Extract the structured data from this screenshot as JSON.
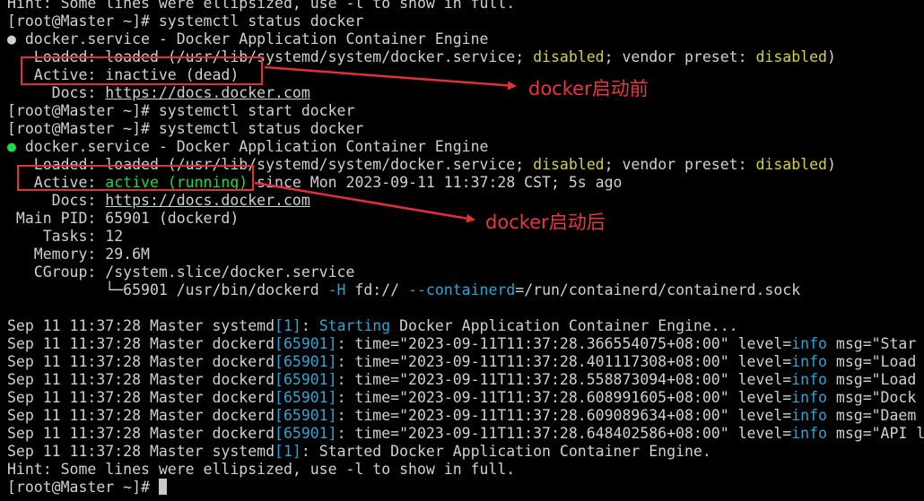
{
  "terminal": {
    "lines": [
      [
        {
          "t": "Hint: Some lines were ellipsized, use -l to show in full.",
          "c": "white"
        }
      ],
      [
        {
          "t": "[root@Master ~]# systemctl status docker",
          "c": "white"
        }
      ],
      [
        {
          "t": "● ",
          "c": "white"
        },
        {
          "t": "docker.service - Docker Application Container Engine",
          "c": "white"
        }
      ],
      [
        {
          "t": "   Loaded: loaded (/usr/lib/systemd/system/docker.service; ",
          "c": "white"
        },
        {
          "t": "disabled",
          "c": "yellow"
        },
        {
          "t": "; vendor preset: ",
          "c": "white"
        },
        {
          "t": "disabled",
          "c": "yellow"
        },
        {
          "t": ")",
          "c": "white"
        }
      ],
      [
        {
          "t": "   Active: inactive (dead)",
          "c": "white"
        }
      ],
      [
        {
          "t": "     Docs: ",
          "c": "white"
        },
        {
          "t": "https://docs.docker.com",
          "c": "white",
          "u": true
        }
      ],
      [
        {
          "t": "[root@Master ~]# systemctl start docker",
          "c": "white"
        }
      ],
      [
        {
          "t": "[root@Master ~]# systemctl status docker",
          "c": "white"
        }
      ],
      [
        {
          "t": "● ",
          "c": "green"
        },
        {
          "t": "docker.service - Docker Application Container Engine",
          "c": "white"
        }
      ],
      [
        {
          "t": "   Loaded: loaded (/usr/lib/systemd/system/docker.service; ",
          "c": "white"
        },
        {
          "t": "disabled",
          "c": "yellow"
        },
        {
          "t": "; vendor preset: ",
          "c": "white"
        },
        {
          "t": "disabled",
          "c": "yellow"
        },
        {
          "t": ")",
          "c": "white"
        }
      ],
      [
        {
          "t": "   Active: ",
          "c": "white"
        },
        {
          "t": "active (running)",
          "c": "green"
        },
        {
          "t": " since Mon 2023-09-11 11:37:28 CST; 5s ago",
          "c": "white"
        }
      ],
      [
        {
          "t": "     Docs: ",
          "c": "white"
        },
        {
          "t": "https://docs.docker.com",
          "c": "white",
          "u": true
        }
      ],
      [
        {
          "t": " Main PID: 65901 (dockerd)",
          "c": "white"
        }
      ],
      [
        {
          "t": "    Tasks: 12",
          "c": "white"
        }
      ],
      [
        {
          "t": "   Memory: 29.6M",
          "c": "white"
        }
      ],
      [
        {
          "t": "   CGroup: /system.slice/docker.service",
          "c": "white"
        }
      ],
      [
        {
          "t": "           └─65901 /usr/bin/dockerd ",
          "c": "white"
        },
        {
          "t": "-H",
          "c": "cyan"
        },
        {
          "t": " fd:// ",
          "c": "white"
        },
        {
          "t": "--containerd",
          "c": "cyan"
        },
        {
          "t": "=/run/containerd/containerd.sock",
          "c": "white"
        }
      ],
      [
        {
          "t": "",
          "c": "white"
        }
      ],
      [
        {
          "t": "Sep 11 11:37:28 Master systemd",
          "c": "white"
        },
        {
          "t": "[1]",
          "c": "cyan"
        },
        {
          "t": ": ",
          "c": "white"
        },
        {
          "t": "Starting",
          "c": "cyan"
        },
        {
          "t": " Docker Application Container Engine...",
          "c": "white"
        }
      ],
      [
        {
          "t": "Sep 11 11:37:28 Master dockerd",
          "c": "white"
        },
        {
          "t": "[65901]",
          "c": "cyan"
        },
        {
          "t": ": time=\"2023-09-11T11:37:28.366554075+08:00\" level=",
          "c": "white"
        },
        {
          "t": "info",
          "c": "cyan"
        },
        {
          "t": " msg=\"Star",
          "c": "white"
        }
      ],
      [
        {
          "t": "Sep 11 11:37:28 Master dockerd",
          "c": "white"
        },
        {
          "t": "[65901]",
          "c": "cyan"
        },
        {
          "t": ": time=\"2023-09-11T11:37:28.401117308+08:00\" level=",
          "c": "white"
        },
        {
          "t": "info",
          "c": "cyan"
        },
        {
          "t": " msg=\"Load",
          "c": "white"
        }
      ],
      [
        {
          "t": "Sep 11 11:37:28 Master dockerd",
          "c": "white"
        },
        {
          "t": "[65901]",
          "c": "cyan"
        },
        {
          "t": ": time=\"2023-09-11T11:37:28.558873094+08:00\" level=",
          "c": "white"
        },
        {
          "t": "info",
          "c": "cyan"
        },
        {
          "t": " msg=\"Load",
          "c": "white"
        }
      ],
      [
        {
          "t": "Sep 11 11:37:28 Master dockerd",
          "c": "white"
        },
        {
          "t": "[65901]",
          "c": "cyan"
        },
        {
          "t": ": time=\"2023-09-11T11:37:28.608991605+08:00\" level=",
          "c": "white"
        },
        {
          "t": "info",
          "c": "cyan"
        },
        {
          "t": " msg=\"Dock",
          "c": "white"
        }
      ],
      [
        {
          "t": "Sep 11 11:37:28 Master dockerd",
          "c": "white"
        },
        {
          "t": "[65901]",
          "c": "cyan"
        },
        {
          "t": ": time=\"2023-09-11T11:37:28.609089634+08:00\" level=",
          "c": "white"
        },
        {
          "t": "info",
          "c": "cyan"
        },
        {
          "t": " msg=\"Daem",
          "c": "white"
        }
      ],
      [
        {
          "t": "Sep 11 11:37:28 Master dockerd",
          "c": "white"
        },
        {
          "t": "[65901]",
          "c": "cyan"
        },
        {
          "t": ": time=\"2023-09-11T11:37:28.648402586+08:00\" level=",
          "c": "white"
        },
        {
          "t": "info",
          "c": "cyan"
        },
        {
          "t": " msg=\"API l",
          "c": "white"
        }
      ],
      [
        {
          "t": "Sep 11 11:37:28 Master systemd",
          "c": "white"
        },
        {
          "t": "[1]",
          "c": "cyan"
        },
        {
          "t": ": Started Docker Application Container Engine.",
          "c": "white"
        }
      ],
      [
        {
          "t": "Hint: Some lines were ellipsized, use -l to show in full.",
          "c": "white"
        }
      ],
      [
        {
          "t": "[root@Master ~]# ",
          "c": "white"
        }
      ]
    ]
  },
  "annotations": {
    "before_label": "docker启动前",
    "after_label": "docker启动后"
  },
  "colors": {
    "background": "#000000",
    "text": "#d0d0d0",
    "green": "#1fd84a",
    "yellow": "#d5d234",
    "cyan": "#2aa6d6",
    "annotation_red": "#e0303a"
  }
}
